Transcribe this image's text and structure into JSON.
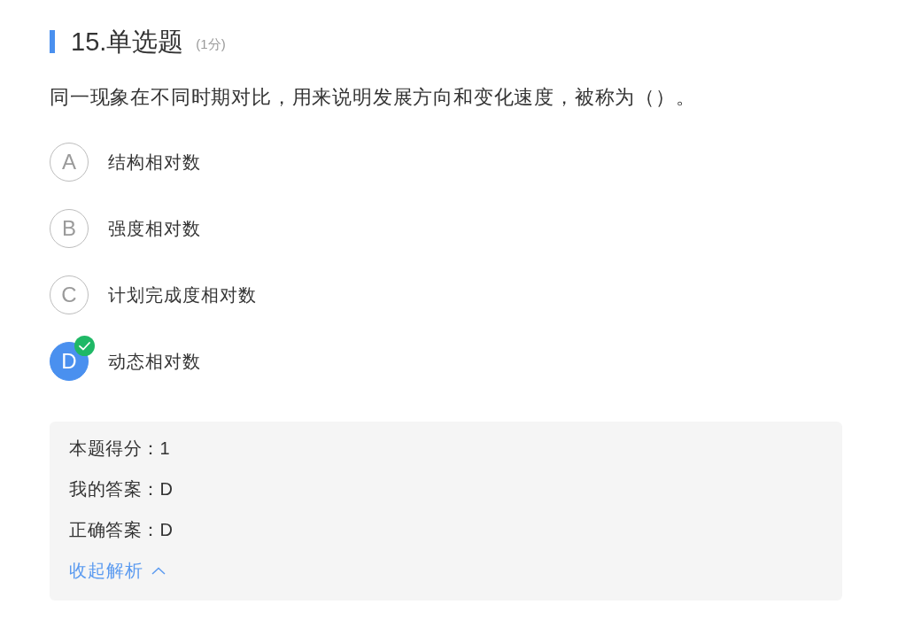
{
  "question": {
    "title": "15.单选题",
    "points": "(1分)",
    "stem": "同一现象在不同时期对比，用来说明发展方向和变化速度，被称为（）。"
  },
  "options": [
    {
      "letter": "A",
      "text": "结构相对数",
      "selected": false,
      "correct": false
    },
    {
      "letter": "B",
      "text": "强度相对数",
      "selected": false,
      "correct": false
    },
    {
      "letter": "C",
      "text": "计划完成度相对数",
      "selected": false,
      "correct": false
    },
    {
      "letter": "D",
      "text": "动态相对数",
      "selected": true,
      "correct": true
    }
  ],
  "analysis": {
    "rows": [
      "本题得分：1",
      "我的答案：D",
      "正确答案：D"
    ],
    "toggle": "收起解析",
    "expanded": true
  }
}
